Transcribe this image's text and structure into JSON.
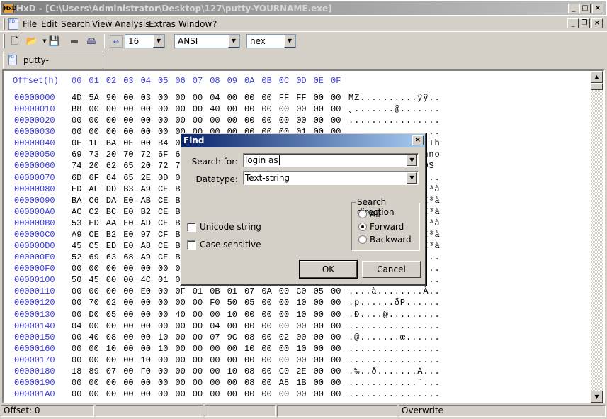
{
  "window": {
    "title": "HxD - [C:\\Users\\Administrator\\Desktop\\127\\putty-YOURNAME.exe]",
    "app_icon": "HxD"
  },
  "menu": [
    "File",
    "Edit",
    "Search",
    "View",
    "Analysis",
    "Extras",
    "Window",
    "?"
  ],
  "toolbar": {
    "bytes_per_row": "16",
    "charset": "ANSI",
    "offset_base": "hex"
  },
  "tab": {
    "label": "putty-YOURNAME.exe"
  },
  "editor": {
    "header_offset": "Offset(h)",
    "header_columns": [
      "00",
      "01",
      "02",
      "03",
      "04",
      "05",
      "06",
      "07",
      "08",
      "09",
      "0A",
      "0B",
      "0C",
      "0D",
      "0E",
      "0F"
    ],
    "rows": [
      {
        "offset": "00000000",
        "hex": "4D 5A 90 00 03 00 00 00 04 00 00 00 FF FF 00 00",
        "ascii": "MZ..........ÿÿ.."
      },
      {
        "offset": "00000010",
        "hex": "B8 00 00 00 00 00 00 00 40 00 00 00 00 00 00 00",
        "ascii": "¸.......@......."
      },
      {
        "offset": "00000020",
        "hex": "00 00 00 00 00 00 00 00 00 00 00 00 00 00 00 00",
        "ascii": "................"
      },
      {
        "offset": "00000030",
        "hex": "00 00 00 00 00 00 00 00 00 00 00 00 00 01 00 00",
        "ascii": "................"
      },
      {
        "offset": "00000040",
        "hex": "0E 1F BA 0E 00 B4 09 CD 21 B8 01 4C CD 21 54 68",
        "ascii": "..º..´.Í!¸.LÍ!Th"
      },
      {
        "offset": "00000050",
        "hex": "69 73 20 70 72 6F 67 72 61 6D 20 63 61 6E 6E 6F",
        "ascii": "is program canno"
      },
      {
        "offset": "00000060",
        "hex": "74 20 62 65 20 72 75 6E 20 69 6E 20 44 4F 53 20",
        "ascii": "t be run in DOS "
      },
      {
        "offset": "00000070",
        "hex": "6D 6F 64 65 2E 0D 0D 0A 24 00 00 00 00 00 00 00",
        "ascii": "mode....$......."
      },
      {
        "offset": "00000080",
        "hex": "ED AF DD B3 A9 CE B3 E0 A9 CE B3 E0 A9 CE B3 E0",
        "ascii": "í¯Ý³©Î³à©Î³à©Î³à"
      },
      {
        "offset": "00000090",
        "hex": "BA C6 DA E0 AB CE B3 E0 2A D2 BD E0 A8 CE B3 E0",
        "ascii": "ºÆÚà«Î³à*Ò½à¨Î³à"
      },
      {
        "offset": "000000A0",
        "hex": "AC C2 BC E0 B2 CE B3 E0 A9 CE B2 E0 63 CF B3 E0",
        "ascii": "¬Â¼à²Î³à©Î²àcÏ³à"
      },
      {
        "offset": "000000B0",
        "hex": "53 ED AA E0 AD CE B3 E0 A9 CE B3 E0 B6 CE B3 E0",
        "ascii": "Síªà.Î³à©Î³à¶Î³à"
      },
      {
        "offset": "000000C0",
        "hex": "A9 CE B2 E0 97 CF B3 E0 A9 CE B3 E0 AB CE B3 E0",
        "ascii": "©Î²à—Ï³à©Î³à«Î³à"
      },
      {
        "offset": "000000D0",
        "hex": "45 C5 ED E0 A8 CE B3 E0 A9 CE B3 E0 A8 CE B3 E0",
        "ascii": "EÅíà¨Î³à©Î³à¨Î³à"
      },
      {
        "offset": "000000E0",
        "hex": "52 69 63 68 A9 CE B3 E0 00 00 00 00 00 00 00 00",
        "ascii": "Rich©Î³à........"
      },
      {
        "offset": "000000F0",
        "hex": "00 00 00 00 00 00 00 00 00 00 00 00 00 00 00 00",
        "ascii": "................"
      },
      {
        "offset": "00000100",
        "hex": "50 45 00 00 4C 01 05 00 E4 3B 2A 5F 00 00 00 00",
        "ascii": "PE..L...ä;*_...."
      },
      {
        "offset": "00000110",
        "hex": "00 00 00 00 E0 00 0F 01 0B 01 07 0A 00 C0 05 00",
        "ascii": "....à........À.."
      },
      {
        "offset": "00000120",
        "hex": "00 70 02 00 00 00 00 00 F0 50 05 00 00 10 00 00",
        "ascii": ".p......ðP......"
      },
      {
        "offset": "00000130",
        "hex": "00 D0 05 00 00 00 40 00 00 10 00 00 00 10 00 00",
        "ascii": ".Ð....@........."
      },
      {
        "offset": "00000140",
        "hex": "04 00 00 00 00 00 00 00 04 00 00 00 00 00 00 00",
        "ascii": "................"
      },
      {
        "offset": "00000150",
        "hex": "00 40 08 00 00 10 00 00 07 9C 08 00 02 00 00 00",
        "ascii": ".@.......œ......"
      },
      {
        "offset": "00000160",
        "hex": "00 00 10 00 00 10 00 00 00 00 10 00 00 10 00 00",
        "ascii": "................"
      },
      {
        "offset": "00000170",
        "hex": "00 00 00 00 10 00 00 00 00 00 00 00 00 00 00 00",
        "ascii": "................"
      },
      {
        "offset": "00000180",
        "hex": "18 89 07 00 F0 00 00 00 00 10 08 00 C0 2E 00 00",
        "ascii": ".‰..ð.......À..."
      },
      {
        "offset": "00000190",
        "hex": "00 00 00 00 00 00 00 00 00 00 08 00 A8 1B 00 00",
        "ascii": "............¨..."
      },
      {
        "offset": "000001A0",
        "hex": "00 00 00 00 00 00 00 00 00 00 00 00 00 00 00 00",
        "ascii": "................"
      },
      {
        "offset": "000001B0",
        "hex": "00 00 00 00 00 00 00 00 00 00 00 00 00 00 00 00",
        "ascii": "................"
      }
    ]
  },
  "status": {
    "offset": "Offset: 0",
    "mode": "Overwrite"
  },
  "find_dialog": {
    "title": "Find",
    "search_label": "Search for:",
    "search_value": "login as",
    "datatype_label": "Datatype:",
    "datatype_value": "Text-string",
    "unicode_label": "Unicode string",
    "unicode_checked": false,
    "case_label": "Case sensitive",
    "case_checked": false,
    "direction_label": "Search direction",
    "directions": [
      "All",
      "Forward",
      "Backward"
    ],
    "selected_direction": "Forward",
    "ok": "OK",
    "cancel": "Cancel"
  }
}
